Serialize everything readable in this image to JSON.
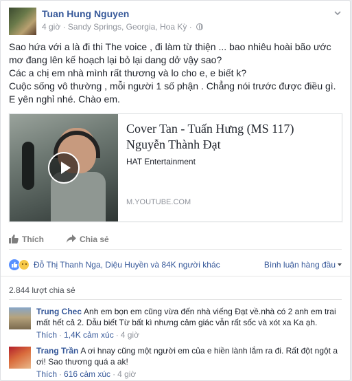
{
  "post": {
    "author": "Tuan Hung Nguyen",
    "time": "4 giờ",
    "location": "Sandy Springs, Georgia, Hoa Kỳ",
    "separator": "·",
    "text_lines": [
      "Sao hứa với a là đi thi The voice , đi làm từ thiện ... bao nhiêu hoài bão ước mơ đang lên kế hoạch lại bỏ lại dang dở vậy sao?",
      "Các a chị em nhà mình rất thương và lo cho e, e biết k?",
      "Cuộc sống vô thường , mỗi người 1 số phận . Chẳng nói trước được điều gì.",
      "E yên nghỉ nhé. Chào em."
    ]
  },
  "link_preview": {
    "title": "Cover Tan - Tuấn Hưng (MS 117) Nguyễn Thành Đạt",
    "source": "HAT Entertainment",
    "domain": "M.YOUTUBE.COM"
  },
  "actions": {
    "like": "Thích",
    "share": "Chia sẻ"
  },
  "reactions": {
    "summary": "Đỗ Thị Thanh Nga, Diệu Huyền và 84K người khác",
    "sort_label": "Bình luận hàng đầu",
    "shares": "2.844 lượt chia sẻ",
    "icons": [
      "like-icon",
      "sad-icon"
    ]
  },
  "comments": [
    {
      "author": "Trung Chec",
      "text": "Anh em bọn em cũng vừa đến nhà viếng Đạt về.nhà có 2 anh em trai mất hết cả 2. Dẫu biết Từ bất kì nhưng cảm giác vẫn rất sốc và xót xa Ka ạh.",
      "like": "Thích",
      "reactions": "1,4K cảm xúc",
      "time": "4 giờ",
      "dot": "·"
    },
    {
      "author": "Trang Trần",
      "text": "A ơi hnay cũng một người em của e hiền lành lắm ra đi. Rất đột ngột a ơi! Sao thương quá a ak!",
      "like": "Thích",
      "reactions": "616 cảm xúc",
      "time": "4 giờ",
      "dot": "·"
    }
  ],
  "colors": {
    "link_blue": "#365899",
    "meta_gray": "#90949c",
    "like_blue": "#5890ff",
    "sad_yellow": "#f7c94a"
  }
}
